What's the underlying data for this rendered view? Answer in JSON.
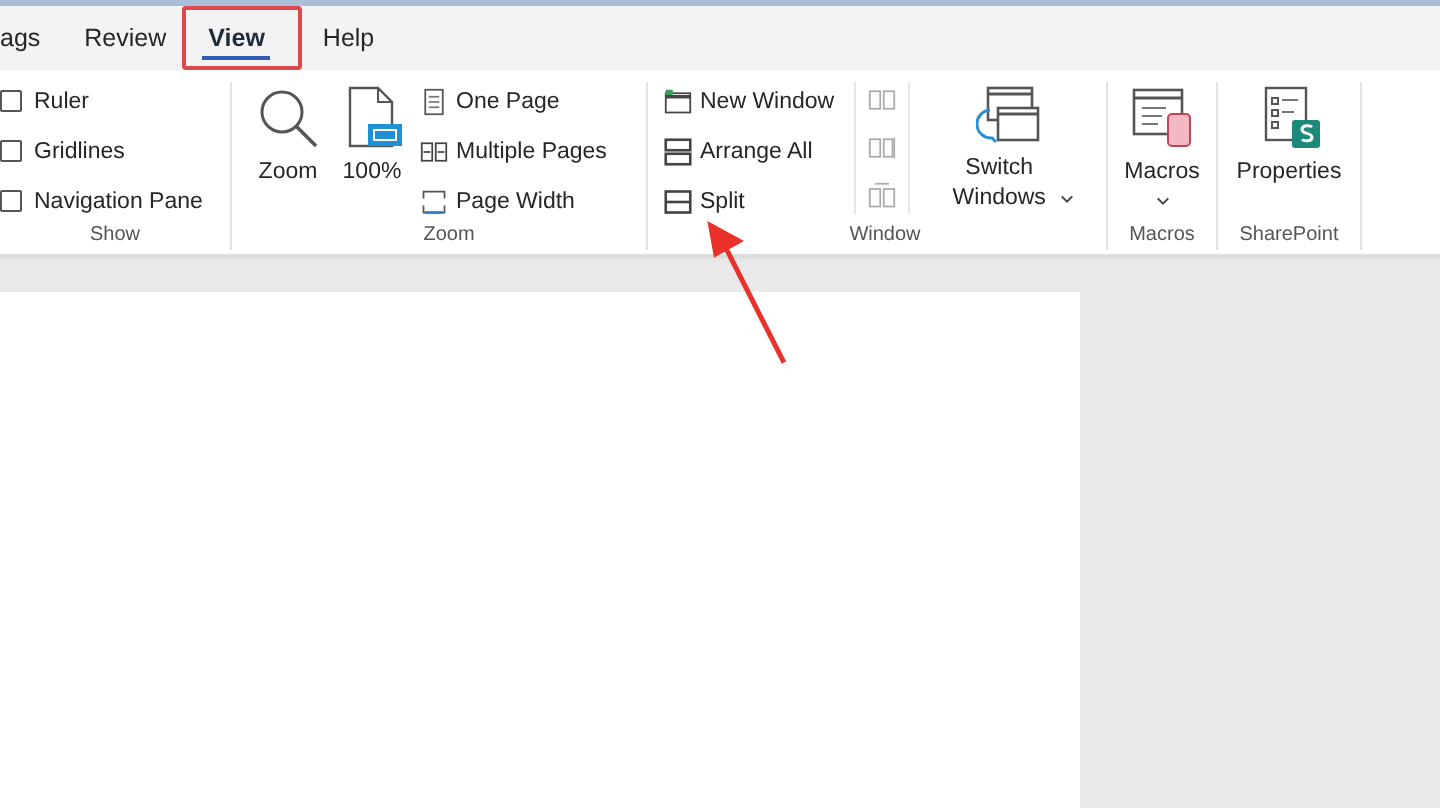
{
  "tabs": [
    {
      "label": "ags",
      "selected": false,
      "highlighted": false
    },
    {
      "label": "Review",
      "selected": false,
      "highlighted": false
    },
    {
      "label": "View",
      "selected": true,
      "highlighted": true
    },
    {
      "label": "Help",
      "selected": false,
      "highlighted": false
    }
  ],
  "ribbon": {
    "groups": [
      {
        "label": "Show",
        "columns": [
          {
            "kind": "checks",
            "items": [
              {
                "label": "Ruler",
                "checked": false
              },
              {
                "label": "Gridlines",
                "checked": false
              },
              {
                "label": "Navigation Pane",
                "checked": false
              }
            ]
          }
        ]
      },
      {
        "label": "Zoom",
        "columns": [
          {
            "kind": "large",
            "label": "Zoom",
            "dropdown": false
          },
          {
            "kind": "large",
            "label": "100%",
            "dropdown": false
          },
          {
            "kind": "list",
            "items": [
              {
                "label": "One Page"
              },
              {
                "label": "Multiple Pages"
              },
              {
                "label": "Page Width"
              }
            ]
          }
        ]
      },
      {
        "label": "Window",
        "columns": [
          {
            "kind": "list",
            "items": [
              {
                "label": "New Window"
              },
              {
                "label": "Arrange All"
              },
              {
                "label": "Split"
              }
            ]
          },
          {
            "kind": "icons",
            "items": [
              {
                "disabled": true
              },
              {
                "disabled": true
              },
              {
                "disabled": true
              }
            ]
          },
          {
            "kind": "large",
            "label": "Switch Windows",
            "dropdown": true
          }
        ]
      },
      {
        "label": "Macros",
        "columns": [
          {
            "kind": "large",
            "label": "Macros",
            "dropdown": true
          }
        ]
      },
      {
        "label": "SharePoint",
        "columns": [
          {
            "kind": "large",
            "label": "Properties",
            "dropdown": false
          }
        ]
      }
    ]
  }
}
